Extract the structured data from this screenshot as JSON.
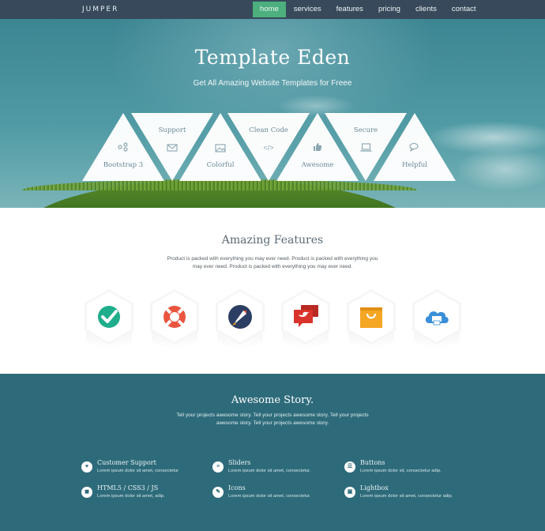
{
  "nav": {
    "logo": "JUMPER",
    "items": [
      {
        "label": "home",
        "active": true
      },
      {
        "label": "services",
        "active": false
      },
      {
        "label": "features",
        "active": false
      },
      {
        "label": "pricing",
        "active": false
      },
      {
        "label": "clients",
        "active": false
      },
      {
        "label": "contact",
        "active": false
      }
    ],
    "active_color": "#4caf7d",
    "bar_color": "#37495a"
  },
  "hero": {
    "title": "Template Eden",
    "subtitle": "Get All Amazing Website Templates for Freee",
    "triangles": [
      {
        "label": "Bootstrap 3",
        "icon": "share-icon",
        "direction": "up"
      },
      {
        "label": "Support",
        "icon": "envelope-icon",
        "direction": "down"
      },
      {
        "label": "Colorful",
        "icon": "image-icon",
        "direction": "up"
      },
      {
        "label": "Clean Code",
        "icon": "code-icon",
        "direction": "down"
      },
      {
        "label": "Awesome",
        "icon": "thumbs-up-icon",
        "direction": "up"
      },
      {
        "label": "Secure",
        "icon": "laptop-icon",
        "direction": "down"
      },
      {
        "label": "Helpful",
        "icon": "chat-icon",
        "direction": "up"
      }
    ]
  },
  "features": {
    "title": "Amazing Features",
    "description": "Product is packed with everything you may ever need. Product is packed with everything you may ever need. Product is packed with everything you may ever need.",
    "icons": [
      {
        "name": "check-badge-icon",
        "color": "#1fae8c"
      },
      {
        "name": "lifebuoy-icon",
        "color": "#e9553f"
      },
      {
        "name": "rocket-icon",
        "color": "#2c3e63"
      },
      {
        "name": "twitter-bubble-icon",
        "color": "#d9342b"
      },
      {
        "name": "shopping-bag-icon",
        "color": "#f5a623"
      },
      {
        "name": "cloud-print-icon",
        "color": "#3a8fd8"
      }
    ]
  },
  "story": {
    "title": "Awesome Story.",
    "description": "Tell your projects awesome story. Tell your projects awesome story. Tell your projects awesome story. Tell your projects awesome story.",
    "services": [
      {
        "title": "Customer Support",
        "text": "Lorem ipsum dolor sit amet, consectetur",
        "icon": "heart-icon"
      },
      {
        "title": "Sliders",
        "text": "Lorem ipsum dolor sit amet, consectetur.",
        "icon": "sliders-icon"
      },
      {
        "title": "Buttons",
        "text": "Lorem ipsum dolor sit, consectetur adip.",
        "icon": "list-icon"
      },
      {
        "title": "HTML5 / CSS3 / JS",
        "text": "Lorem ipsum dolor sit amet, adip.",
        "icon": "code-file-icon"
      },
      {
        "title": "Icons",
        "text": "Lorem ipsum dolor sit amet, consectetur.",
        "icon": "brush-icon"
      },
      {
        "title": "Lightbox",
        "text": "Lorem ipsum dolor sit amet, consectetur adip.",
        "icon": "monitor-icon"
      }
    ],
    "background": "#2e6b7a"
  }
}
